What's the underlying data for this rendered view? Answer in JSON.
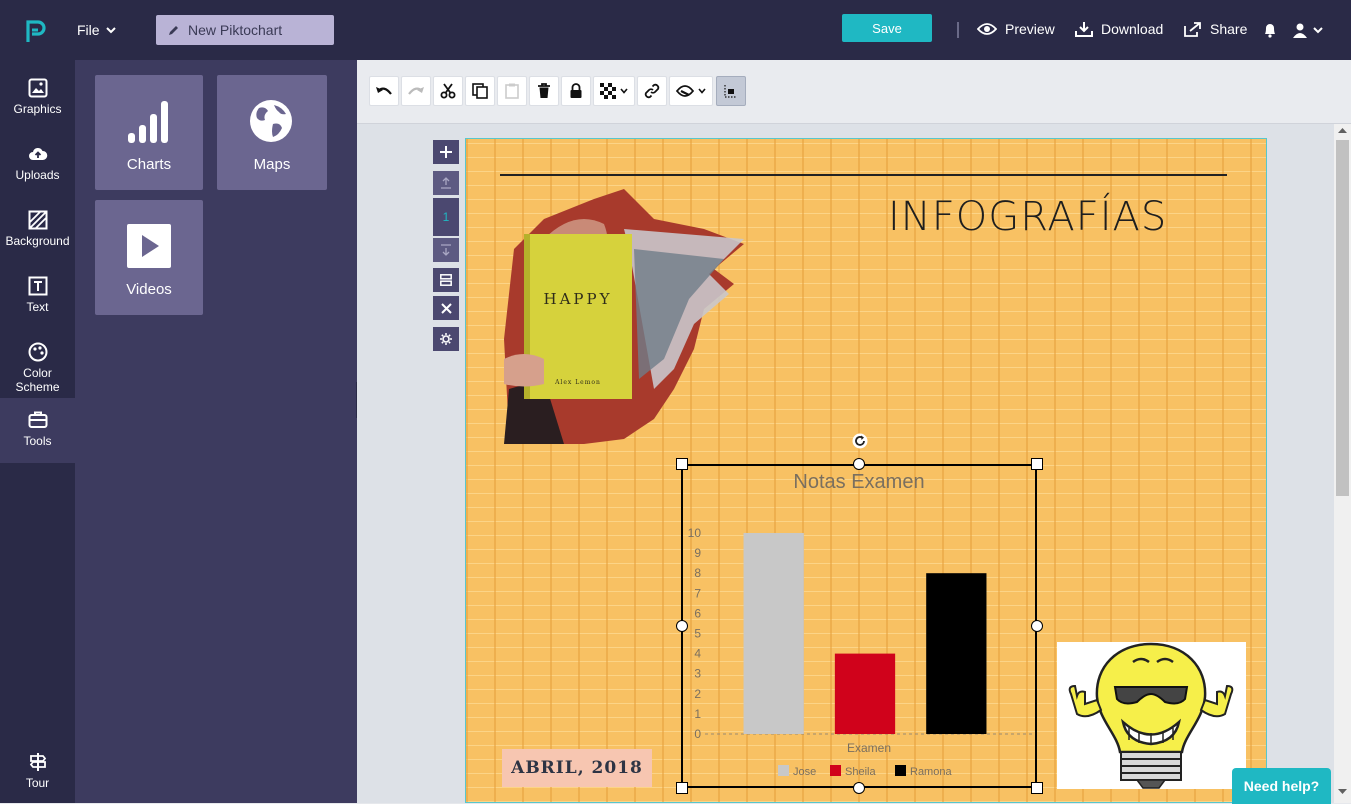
{
  "topbar": {
    "file_label": "File",
    "doc_title": "New Piktochart",
    "save_label": "Save",
    "preview_label": "Preview",
    "download_label": "Download",
    "share_label": "Share"
  },
  "leftnav": {
    "items": [
      {
        "label": "Graphics",
        "icon": "image-icon"
      },
      {
        "label": "Uploads",
        "icon": "cloud-upload-icon"
      },
      {
        "label": "Background",
        "icon": "background-icon"
      },
      {
        "label": "Text",
        "icon": "text-icon"
      },
      {
        "label": "Color Scheme",
        "icon": "palette-icon"
      },
      {
        "label": "Tools",
        "icon": "toolbox-icon",
        "active": true
      }
    ],
    "tour_label": "Tour"
  },
  "panel": {
    "tiles": [
      {
        "label": "Charts",
        "icon": "bar-chart-icon"
      },
      {
        "label": "Maps",
        "icon": "globe-icon"
      },
      {
        "label": "Videos",
        "icon": "play-icon"
      }
    ]
  },
  "page_controls": {
    "page_number": "1"
  },
  "infographic": {
    "title": "INFOGRAFÍAS",
    "book_title": "HAPPY",
    "book_author": "Alex Lemon",
    "date_text": "ABRIL, 2018"
  },
  "chart_data": {
    "type": "bar",
    "title": "Notas Examen",
    "xlabel": "Examen",
    "ylabel": "",
    "categories": [
      "Examen"
    ],
    "series": [
      {
        "name": "Jose",
        "values": [
          10
        ],
        "color": "#c8c8c8"
      },
      {
        "name": "Sheila",
        "values": [
          4
        ],
        "color": "#d0021b"
      },
      {
        "name": "Ramona",
        "values": [
          8
        ],
        "color": "#000000"
      }
    ],
    "ylim": [
      0,
      10
    ],
    "yticks": [
      "0",
      "1",
      "2",
      "3",
      "4",
      "5",
      "6",
      "7",
      "8",
      "9",
      "10"
    ],
    "legend": "bottom",
    "grid": false
  },
  "help": {
    "label": "Need help?"
  },
  "colors": {
    "accent": "#1fb8c3",
    "nav_bg": "#2a2a47",
    "panel_bg": "#3d3b5f",
    "canvas_bg": "#f8c163"
  }
}
